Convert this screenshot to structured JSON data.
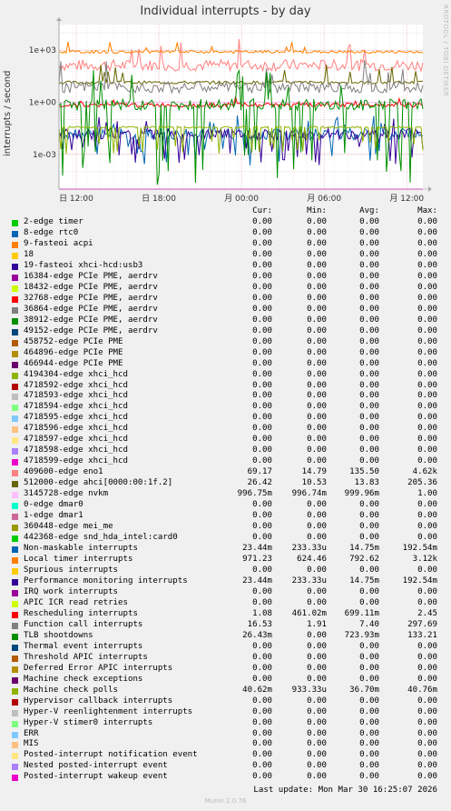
{
  "title": "Individual interrupts - by day",
  "side_mark": "RRDTOOL / TOBI OETIKER",
  "footer": {
    "last_update": "Last update: Mon Mar 30 16:25:07 2026",
    "version": "Munin 2.0.76"
  },
  "legend_header": {
    "cur": "Cur:",
    "min": "Min:",
    "avg": "Avg:",
    "max": "Max:"
  },
  "chart_data": {
    "type": "line",
    "title": "Individual interrupts - by day",
    "ylabel": "interrupts / second",
    "yscale": "log",
    "ylim": [
      1e-05,
      30000
    ],
    "yticks": [
      0.001,
      1,
      1000
    ],
    "ytick_labels": [
      "1e-03",
      "1e+00",
      "1e+03"
    ],
    "x_ticks": [
      "日 12:00",
      "日 18:00",
      "月 00:00",
      "月 06:00",
      "月 12:00"
    ],
    "grid": true,
    "series": [
      {
        "name": "2-edge timer",
        "color": "#00cc00",
        "cur": "0.00",
        "min": "0.00",
        "avg": "0.00",
        "max": "0.00"
      },
      {
        "name": "8-edge rtc0",
        "color": "#0066b3",
        "cur": "0.00",
        "min": "0.00",
        "avg": "0.00",
        "max": "0.00"
      },
      {
        "name": "9-fasteoi acpi",
        "color": "#ff8000",
        "cur": "0.00",
        "min": "0.00",
        "avg": "0.00",
        "max": "0.00"
      },
      {
        "name": "18",
        "color": "#ffcc00",
        "cur": "0.00",
        "min": "0.00",
        "avg": "0.00",
        "max": "0.00"
      },
      {
        "name": "19-fasteoi xhci-hcd:usb3",
        "color": "#330099",
        "cur": "0.00",
        "min": "0.00",
        "avg": "0.00",
        "max": "0.00"
      },
      {
        "name": "16384-edge PCIe PME, aerdrv",
        "color": "#990099",
        "cur": "0.00",
        "min": "0.00",
        "avg": "0.00",
        "max": "0.00"
      },
      {
        "name": "18432-edge PCIe PME, aerdrv",
        "color": "#ccff00",
        "cur": "0.00",
        "min": "0.00",
        "avg": "0.00",
        "max": "0.00"
      },
      {
        "name": "32768-edge PCIe PME, aerdrv",
        "color": "#ff0000",
        "cur": "0.00",
        "min": "0.00",
        "avg": "0.00",
        "max": "0.00"
      },
      {
        "name": "36864-edge PCIe PME, aerdrv",
        "color": "#808080",
        "cur": "0.00",
        "min": "0.00",
        "avg": "0.00",
        "max": "0.00"
      },
      {
        "name": "38912-edge PCIe PME, aerdrv",
        "color": "#008f00",
        "cur": "0.00",
        "min": "0.00",
        "avg": "0.00",
        "max": "0.00"
      },
      {
        "name": "49152-edge PCIe PME, aerdrv",
        "color": "#00487d",
        "cur": "0.00",
        "min": "0.00",
        "avg": "0.00",
        "max": "0.00"
      },
      {
        "name": "458752-edge PCIe PME",
        "color": "#b35a00",
        "cur": "0.00",
        "min": "0.00",
        "avg": "0.00",
        "max": "0.00"
      },
      {
        "name": "464896-edge PCIe PME",
        "color": "#b38f00",
        "cur": "0.00",
        "min": "0.00",
        "avg": "0.00",
        "max": "0.00"
      },
      {
        "name": "466944-edge PCIe PME",
        "color": "#6b006b",
        "cur": "0.00",
        "min": "0.00",
        "avg": "0.00",
        "max": "0.00"
      },
      {
        "name": "4194304-edge xhci_hcd",
        "color": "#8fb300",
        "cur": "0.00",
        "min": "0.00",
        "avg": "0.00",
        "max": "0.00"
      },
      {
        "name": "4718592-edge xhci_hcd",
        "color": "#b30000",
        "cur": "0.00",
        "min": "0.00",
        "avg": "0.00",
        "max": "0.00"
      },
      {
        "name": "4718593-edge xhci_hcd",
        "color": "#bebebe",
        "cur": "0.00",
        "min": "0.00",
        "avg": "0.00",
        "max": "0.00"
      },
      {
        "name": "4718594-edge xhci_hcd",
        "color": "#80ff80",
        "cur": "0.00",
        "min": "0.00",
        "avg": "0.00",
        "max": "0.00"
      },
      {
        "name": "4718595-edge xhci_hcd",
        "color": "#80c9ff",
        "cur": "0.00",
        "min": "0.00",
        "avg": "0.00",
        "max": "0.00"
      },
      {
        "name": "4718596-edge xhci_hcd",
        "color": "#ffc080",
        "cur": "0.00",
        "min": "0.00",
        "avg": "0.00",
        "max": "0.00"
      },
      {
        "name": "4718597-edge xhci_hcd",
        "color": "#ffe680",
        "cur": "0.00",
        "min": "0.00",
        "avg": "0.00",
        "max": "0.00"
      },
      {
        "name": "4718598-edge xhci_hcd",
        "color": "#aa80ff",
        "cur": "0.00",
        "min": "0.00",
        "avg": "0.00",
        "max": "0.00"
      },
      {
        "name": "4718599-edge xhci_hcd",
        "color": "#ee00cc",
        "cur": "0.00",
        "min": "0.00",
        "avg": "0.00",
        "max": "0.00"
      },
      {
        "name": "409600-edge eno1",
        "color": "#ff8080",
        "cur": "69.17",
        "min": "14.79",
        "avg": "135.50",
        "max": "4.62k"
      },
      {
        "name": "512000-edge ahci[0000:00:1f.2]",
        "color": "#666600",
        "cur": "26.42",
        "min": "10.53",
        "avg": "13.83",
        "max": "205.36"
      },
      {
        "name": "3145728-edge nvkm",
        "color": "#ffbfff",
        "cur": "996.75m",
        "min": "996.74m",
        "avg": "999.96m",
        "max": "1.00"
      },
      {
        "name": "0-edge dmar0",
        "color": "#00ffcc",
        "cur": "0.00",
        "min": "0.00",
        "avg": "0.00",
        "max": "0.00"
      },
      {
        "name": "1-edge dmar1",
        "color": "#cc6699",
        "cur": "0.00",
        "min": "0.00",
        "avg": "0.00",
        "max": "0.00"
      },
      {
        "name": "360448-edge mei_me",
        "color": "#999900",
        "cur": "0.00",
        "min": "0.00",
        "avg": "0.00",
        "max": "0.00"
      },
      {
        "name": "442368-edge snd_hda_intel:card0",
        "color": "#00cc00",
        "cur": "0.00",
        "min": "0.00",
        "avg": "0.00",
        "max": "0.00"
      },
      {
        "name": "Non-maskable interrupts",
        "color": "#0066b3",
        "cur": "23.44m",
        "min": "233.33u",
        "avg": "14.75m",
        "max": "192.54m"
      },
      {
        "name": "Local timer interrupts",
        "color": "#ff8000",
        "cur": "971.23",
        "min": "624.46",
        "avg": "792.62",
        "max": "3.12k"
      },
      {
        "name": "Spurious interrupts",
        "color": "#ffcc00",
        "cur": "0.00",
        "min": "0.00",
        "avg": "0.00",
        "max": "0.00"
      },
      {
        "name": "Performance monitoring interrupts",
        "color": "#330099",
        "cur": "23.44m",
        "min": "233.33u",
        "avg": "14.75m",
        "max": "192.54m"
      },
      {
        "name": "IRQ work interrupts",
        "color": "#990099",
        "cur": "0.00",
        "min": "0.00",
        "avg": "0.00",
        "max": "0.00"
      },
      {
        "name": "APIC ICR read retries",
        "color": "#ccff00",
        "cur": "0.00",
        "min": "0.00",
        "avg": "0.00",
        "max": "0.00"
      },
      {
        "name": "Rescheduling interrupts",
        "color": "#ff0000",
        "cur": "1.08",
        "min": "461.02m",
        "avg": "699.11m",
        "max": "2.45"
      },
      {
        "name": "Function call interrupts",
        "color": "#808080",
        "cur": "16.53",
        "min": "1.91",
        "avg": "7.40",
        "max": "297.69"
      },
      {
        "name": "TLB shootdowns",
        "color": "#008f00",
        "cur": "26.43m",
        "min": "0.00",
        "avg": "723.93m",
        "max": "133.21"
      },
      {
        "name": "Thermal event interrupts",
        "color": "#00487d",
        "cur": "0.00",
        "min": "0.00",
        "avg": "0.00",
        "max": "0.00"
      },
      {
        "name": "Threshold APIC interrupts",
        "color": "#b35a00",
        "cur": "0.00",
        "min": "0.00",
        "avg": "0.00",
        "max": "0.00"
      },
      {
        "name": "Deferred Error APIC interrupts",
        "color": "#b38f00",
        "cur": "0.00",
        "min": "0.00",
        "avg": "0.00",
        "max": "0.00"
      },
      {
        "name": "Machine check exceptions",
        "color": "#6b006b",
        "cur": "0.00",
        "min": "0.00",
        "avg": "0.00",
        "max": "0.00"
      },
      {
        "name": "Machine check polls",
        "color": "#8fb300",
        "cur": "40.62m",
        "min": "933.33u",
        "avg": "36.70m",
        "max": "40.76m"
      },
      {
        "name": "Hypervisor callback interrupts",
        "color": "#b30000",
        "cur": "0.00",
        "min": "0.00",
        "avg": "0.00",
        "max": "0.00"
      },
      {
        "name": "Hyper-V reenlightenment interrupts",
        "color": "#bebebe",
        "cur": "0.00",
        "min": "0.00",
        "avg": "0.00",
        "max": "0.00"
      },
      {
        "name": "Hyper-V stimer0 interrupts",
        "color": "#80ff80",
        "cur": "0.00",
        "min": "0.00",
        "avg": "0.00",
        "max": "0.00"
      },
      {
        "name": "ERR",
        "color": "#80c9ff",
        "cur": "0.00",
        "min": "0.00",
        "avg": "0.00",
        "max": "0.00"
      },
      {
        "name": "MIS",
        "color": "#ffc080",
        "cur": "0.00",
        "min": "0.00",
        "avg": "0.00",
        "max": "0.00"
      },
      {
        "name": "Posted-interrupt notification event",
        "color": "#ffe680",
        "cur": "0.00",
        "min": "0.00",
        "avg": "0.00",
        "max": "0.00"
      },
      {
        "name": "Nested posted-interrupt event",
        "color": "#aa80ff",
        "cur": "0.00",
        "min": "0.00",
        "avg": "0.00",
        "max": "0.00"
      },
      {
        "name": "Posted-interrupt wakeup event",
        "color": "#ee00cc",
        "cur": "0.00",
        "min": "0.00",
        "avg": "0.00",
        "max": "0.00"
      }
    ]
  }
}
